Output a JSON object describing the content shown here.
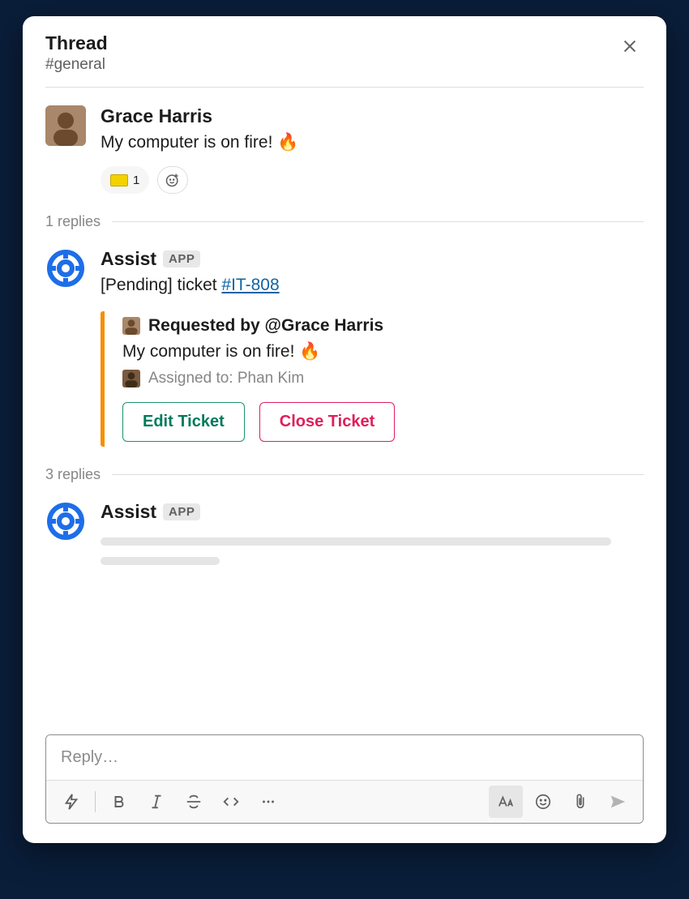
{
  "header": {
    "title": "Thread",
    "channel": "#general"
  },
  "messages": {
    "m1": {
      "author": "Grace Harris",
      "text": "My computer is on fire! 🔥",
      "reaction_count": "1"
    },
    "sep1": {
      "label": "1 replies"
    },
    "m2": {
      "author": "Assist",
      "badge": "APP",
      "text_prefix": "[Pending] ticket ",
      "ticket_id": "#IT-808",
      "attachment": {
        "requested_by": "Requested by @Grace Harris",
        "body": "My computer is on fire! 🔥",
        "assigned_label": "Assigned to: Phan Kim",
        "edit_btn": "Edit Ticket",
        "close_btn": "Close Ticket"
      }
    },
    "sep2": {
      "label": "3 replies"
    },
    "m3": {
      "author": "Assist",
      "badge": "APP"
    }
  },
  "composer": {
    "placeholder": "Reply…"
  }
}
